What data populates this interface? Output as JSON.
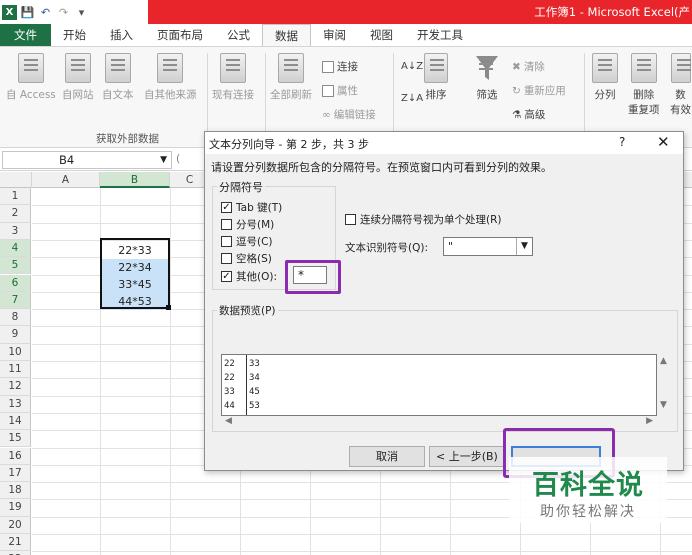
{
  "window": {
    "title": "工作簿1 - Microsoft Excel(产"
  },
  "tabs": [
    {
      "label": "文件"
    },
    {
      "label": "开始"
    },
    {
      "label": "插入"
    },
    {
      "label": "页面布局"
    },
    {
      "label": "公式"
    },
    {
      "label": "数据"
    },
    {
      "label": "审阅"
    },
    {
      "label": "视图"
    },
    {
      "label": "开发工具"
    }
  ],
  "active_tab": "数据",
  "ribbon": {
    "access": "自 Access",
    "web": "自网站",
    "text": "自文本",
    "other": "自其他来源",
    "existing": "现有连接",
    "refresh_all": "全部刷新",
    "connections": "连接",
    "properties": "属性",
    "edit_links": "编辑链接",
    "sort_az": "A→Z",
    "sort": "排序",
    "filter": "筛选",
    "clear": "清除",
    "reapply": "重新应用",
    "advanced": "高级",
    "split": "分列",
    "remove_dup": "删除",
    "remove_dup2": "重复项",
    "validate": "数",
    "validate2": "有效",
    "group_external": "获取外部数据"
  },
  "formula_bar": {
    "name_box": "B4"
  },
  "grid": {
    "columns": [
      "A",
      "B",
      "C"
    ],
    "rows": [
      "1",
      "2",
      "3",
      "4",
      "5",
      "6",
      "7",
      "8",
      "9",
      "10",
      "11",
      "12",
      "13",
      "14",
      "15",
      "16",
      "17",
      "18",
      "19",
      "20",
      "21",
      "22"
    ],
    "cells": [
      {
        "row": "4",
        "value": "22*33"
      },
      {
        "row": "5",
        "value": "22*34"
      },
      {
        "row": "6",
        "value": "33*45"
      },
      {
        "row": "7",
        "value": "44*53"
      }
    ]
  },
  "dialog": {
    "title": "文本分列向导 - 第 2 步，共 3 步",
    "help": "?",
    "close": "✕",
    "instruction": "请设置分列数据所包含的分隔符号。在预览窗口内可看到分列的效果。",
    "delimiter_group": "分隔符号",
    "delimiters": [
      {
        "label": "Tab 键(T)",
        "checked": "☑"
      },
      {
        "label": "分号(M)",
        "checked": ""
      },
      {
        "label": "逗号(C)",
        "checked": ""
      },
      {
        "label": "空格(S)",
        "checked": ""
      },
      {
        "label": "其他(O):",
        "checked": "☑"
      }
    ],
    "other_value": "*",
    "consecutive": "连续分隔符号视为单个处理(R)",
    "qualifier_label": "文本识别符号(Q):",
    "qualifier_value": "\"",
    "preview_label": "数据预览(P)",
    "preview_rows": [
      {
        "c1": "22",
        "c2": "33"
      },
      {
        "c1": "22",
        "c2": "34"
      },
      {
        "c1": "33",
        "c2": "45"
      },
      {
        "c1": "44",
        "c2": "53"
      }
    ],
    "cancel": "取消",
    "back": "< 上一步(B)",
    "next": ""
  },
  "watermark": {
    "title": "百科全说",
    "subtitle": "助你轻松解决"
  },
  "colors": {
    "excel_green": "#1e7145",
    "title_red": "#e8252a",
    "highlight_purple": "#8a2bb0",
    "selection_blue": "#c9e2f8"
  }
}
